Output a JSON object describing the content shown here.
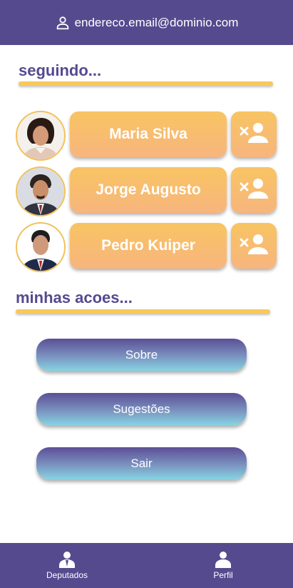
{
  "header": {
    "email": "endereco.email@dominio.com",
    "icon": "person-outline-icon"
  },
  "following": {
    "title": "seguindo...",
    "items": [
      {
        "name": "Maria Silva"
      },
      {
        "name": "Jorge Augusto"
      },
      {
        "name": "Pedro Kuiper"
      }
    ]
  },
  "actions": {
    "title": "minhas acoes...",
    "buttons": [
      {
        "label": "Sobre"
      },
      {
        "label": "Sugestões"
      },
      {
        "label": "Sair"
      }
    ]
  },
  "bottom_nav": {
    "items": [
      {
        "label": "Deputados",
        "icon": "deputados-icon"
      },
      {
        "label": "Perfil",
        "icon": "profile-icon"
      }
    ]
  },
  "colors": {
    "primary": "#564a8f",
    "accent": "#f7c85c",
    "button_gradient_top": "#f8c462",
    "button_gradient_bottom": "#f7b57e"
  }
}
